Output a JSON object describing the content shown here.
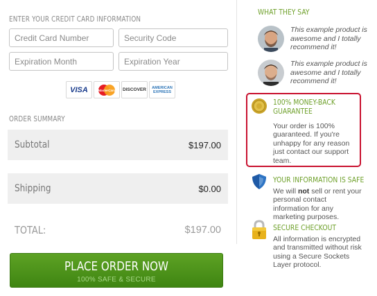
{
  "card_section": {
    "title": "ENTER YOUR CREDIT CARD INFORMATION",
    "card_number_placeholder": "Credit Card Number",
    "security_code_placeholder": "Security Code",
    "exp_month_placeholder": "Expiration Month",
    "exp_year_placeholder": "Expiration Year",
    "card_logos": {
      "visa": "VISA",
      "mastercard": "MasterCard",
      "discover": "DISCOVER",
      "amex_line1": "AMERICAN",
      "amex_line2": "EXPRESS"
    }
  },
  "order_summary": {
    "title": "ORDER SUMMARY",
    "subtotal_label": "Subtotal",
    "subtotal_value": "$197.00",
    "shipping_label": "Shipping",
    "shipping_value": "$0.00",
    "total_label": "TOTAL:",
    "total_value": "$197.00"
  },
  "place_order": {
    "label": "PLACE ORDER NOW",
    "sublabel": "100% SAFE & SECURE"
  },
  "testimonials": {
    "title": "WHAT THEY SAY",
    "items": [
      {
        "quote": "This example product is awesome and I totally recommend it!"
      },
      {
        "quote": "This example product is awesome and I totally recommend it!"
      }
    ]
  },
  "money_back": {
    "title_line1": "100% MONEY-BACK",
    "title_line2": "GUARANTEE",
    "body": "Your order is 100% guaranteed. If you're unhappy for any reason just contact our support team.",
    "border_color": "#c8102e"
  },
  "info_safe": {
    "title": "YOUR INFORMATION IS SAFE",
    "body_before": "We will ",
    "body_bold": "not",
    "body_after": " sell or rent your personal contact information for any marketing purposes."
  },
  "secure_checkout": {
    "title": "SECURE CHECKOUT",
    "body": "All information is encrypted and transmitted without risk using a Secure Sockets Layer protocol."
  },
  "colors": {
    "accent_green": "#6ea02a",
    "button_green": "#4e961c"
  }
}
